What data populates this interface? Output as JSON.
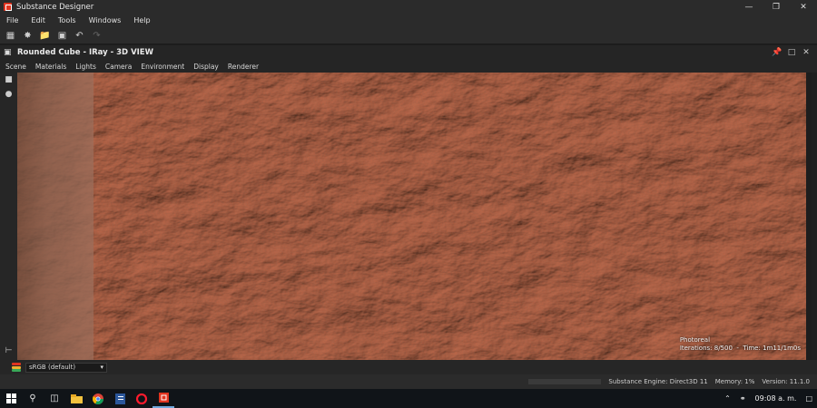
{
  "window": {
    "title": "Substance Designer",
    "minimize_icon": "minimize-icon",
    "maximize_icon": "restore-icon",
    "close_icon": "close-icon"
  },
  "menu": [
    "File",
    "Edit",
    "Tools",
    "Windows",
    "Help"
  ],
  "toolbar": {
    "buttons": [
      "new-package-icon",
      "new-graph-icon",
      "open-folder-icon",
      "save-all-icon",
      "undo-icon",
      "redo-icon"
    ]
  },
  "view": {
    "title": "Rounded Cube - IRay - 3D VIEW",
    "menu": [
      "Scene",
      "Materials",
      "Lights",
      "Camera",
      "Environment",
      "Display",
      "Renderer"
    ],
    "overlay": {
      "mode": "Photoreal",
      "iterations": "Iterations: 8/500",
      "time": "Time: 1m11/1m0s"
    }
  },
  "bottom": {
    "colorspace": "sRGB (default)"
  },
  "status": {
    "engine": "Substance Engine: Direct3D 11",
    "memory": "Memory: 1%",
    "version": "Version: 11.1.0"
  },
  "taskbar": {
    "apps": [
      "file-explorer-icon",
      "chrome-icon",
      "word-icon",
      "opera-icon",
      "substance-icon"
    ],
    "clock": "09:08 a. m."
  },
  "colors": {
    "accent": "#e0341f",
    "background": "#2b2b2b",
    "rock": "#a4705a"
  }
}
